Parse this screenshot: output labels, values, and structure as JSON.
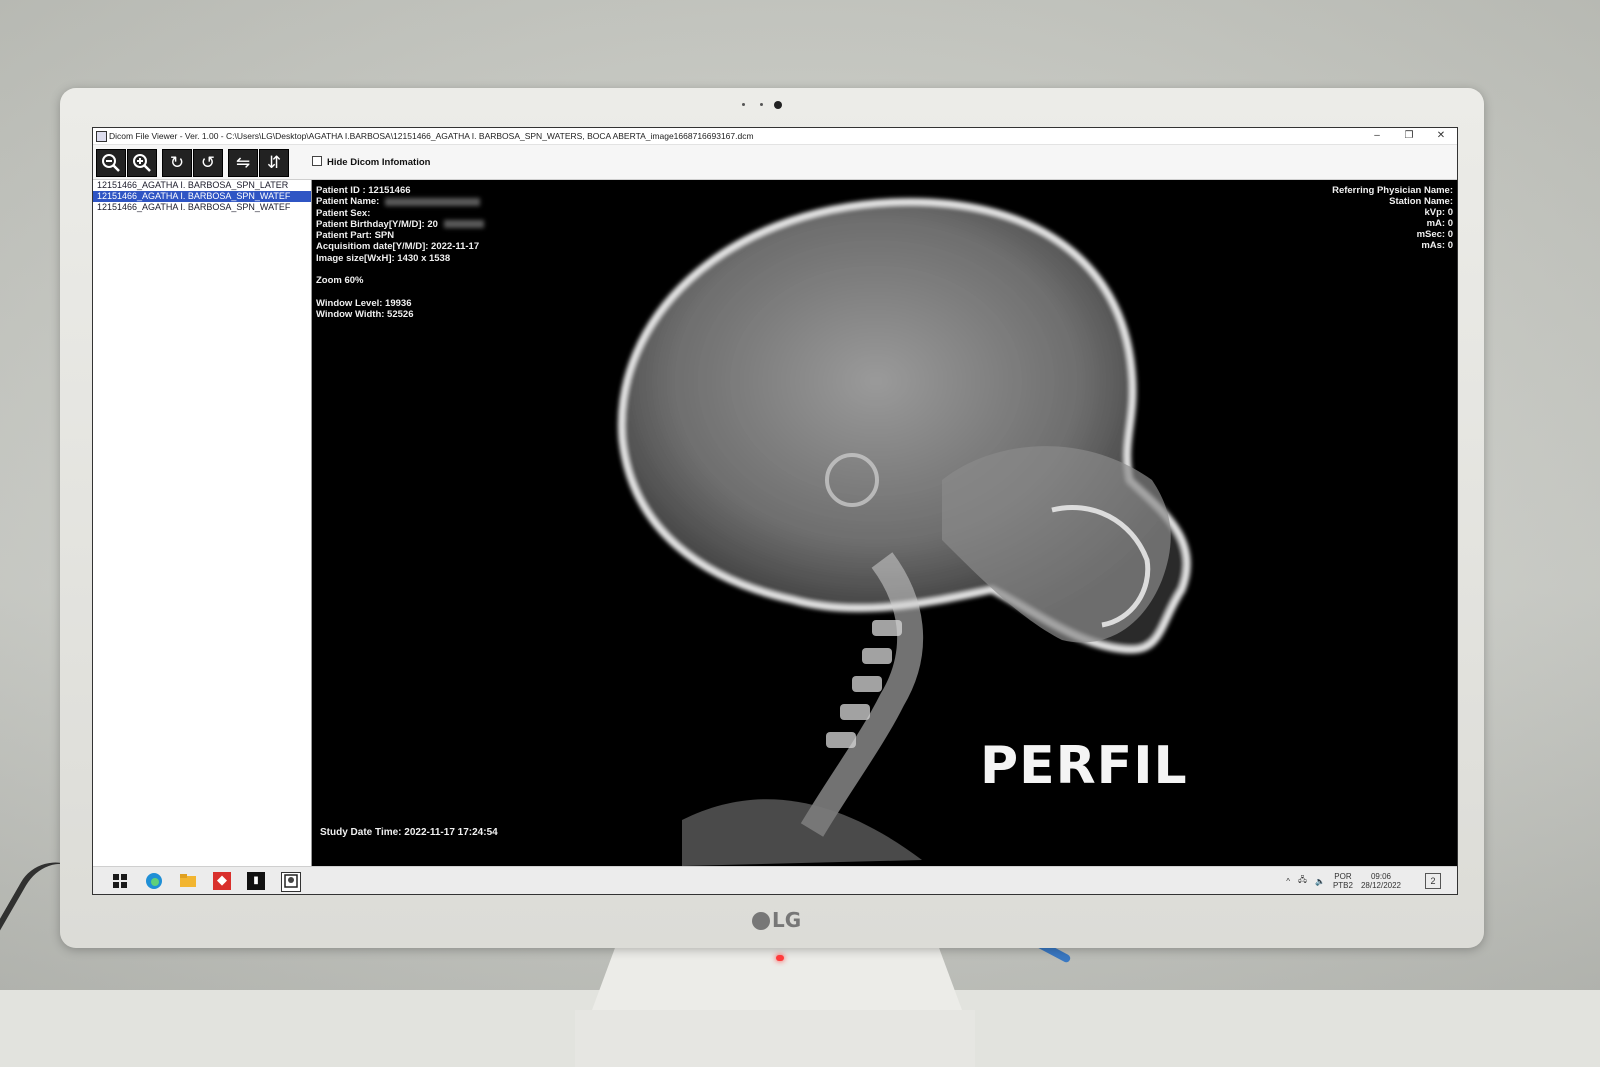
{
  "window": {
    "title": "Dicom File Viewer - Ver. 1.00 - C:\\Users\\LG\\Desktop\\AGATHA I.BARBOSA\\12151466_AGATHA I. BARBOSA_SPN_WATERS, BOCA ABERTA_image1668716693167.dcm",
    "minimize": "–",
    "restore": "❐",
    "close": "✕"
  },
  "toolbar": {
    "zoom_out_icon": "🔍−",
    "zoom_in_icon": "🔍+",
    "rotate_cw_icon": "↻",
    "rotate_ccw_icon": "↺",
    "flip_horizontal_icon": "⇋",
    "flip_vertical_icon": "⇵",
    "hide_dicom_label": "Hide Dicom Infomation"
  },
  "files": [
    {
      "name": "12151466_AGATHA I. BARBOSA_SPN_LATER",
      "selected": false
    },
    {
      "name": "12151466_AGATHA I. BARBOSA_SPN_WATEF",
      "selected": true
    },
    {
      "name": "12151466_AGATHA I. BARBOSA_SPN_WATEF",
      "selected": false
    }
  ],
  "dicom_info": {
    "patient_id": "Patient ID : 12151466",
    "patient_name": "Patient Name:",
    "patient_sex": "Patient Sex:",
    "patient_birthday": "Patient Birthday[Y/M/D]: 20",
    "patient_part": "Patient Part: SPN",
    "acquisition_date": "Acquisitiom date[Y/M/D]: 2022-11-17",
    "image_size": "Image size[WxH]: 1430 x 1538",
    "zoom": "Zoom 60%",
    "window_level": "Window Level: 19936",
    "window_width": "Window Width: 52526",
    "study_date_time": "Study Date Time: 2022-11-17 17:24:54"
  },
  "dicom_right": {
    "referring_physician": "Referring Physician Name:",
    "station_name": "Station Name:",
    "kvp": "kVp: 0",
    "ma": "mA: 0",
    "msec": "mSec: 0",
    "mas": "mAs: 0"
  },
  "image_label": "PERFIL",
  "taskbar": {
    "start_icon": "windows-start",
    "apps": [
      "edge-browser",
      "file-explorer",
      "anydesk",
      "app-black",
      "dicom-viewer"
    ],
    "tray_arrow": "^",
    "lang_top": "POR",
    "lang_bottom": "PTB2",
    "time": "09:06",
    "date": "28/12/2022",
    "notifications": "2"
  },
  "monitor": {
    "brand": "LG"
  },
  "colors": {
    "selection": "#2f55c4",
    "viewer_bg": "#000000",
    "power_led": "#ff3b3b"
  }
}
